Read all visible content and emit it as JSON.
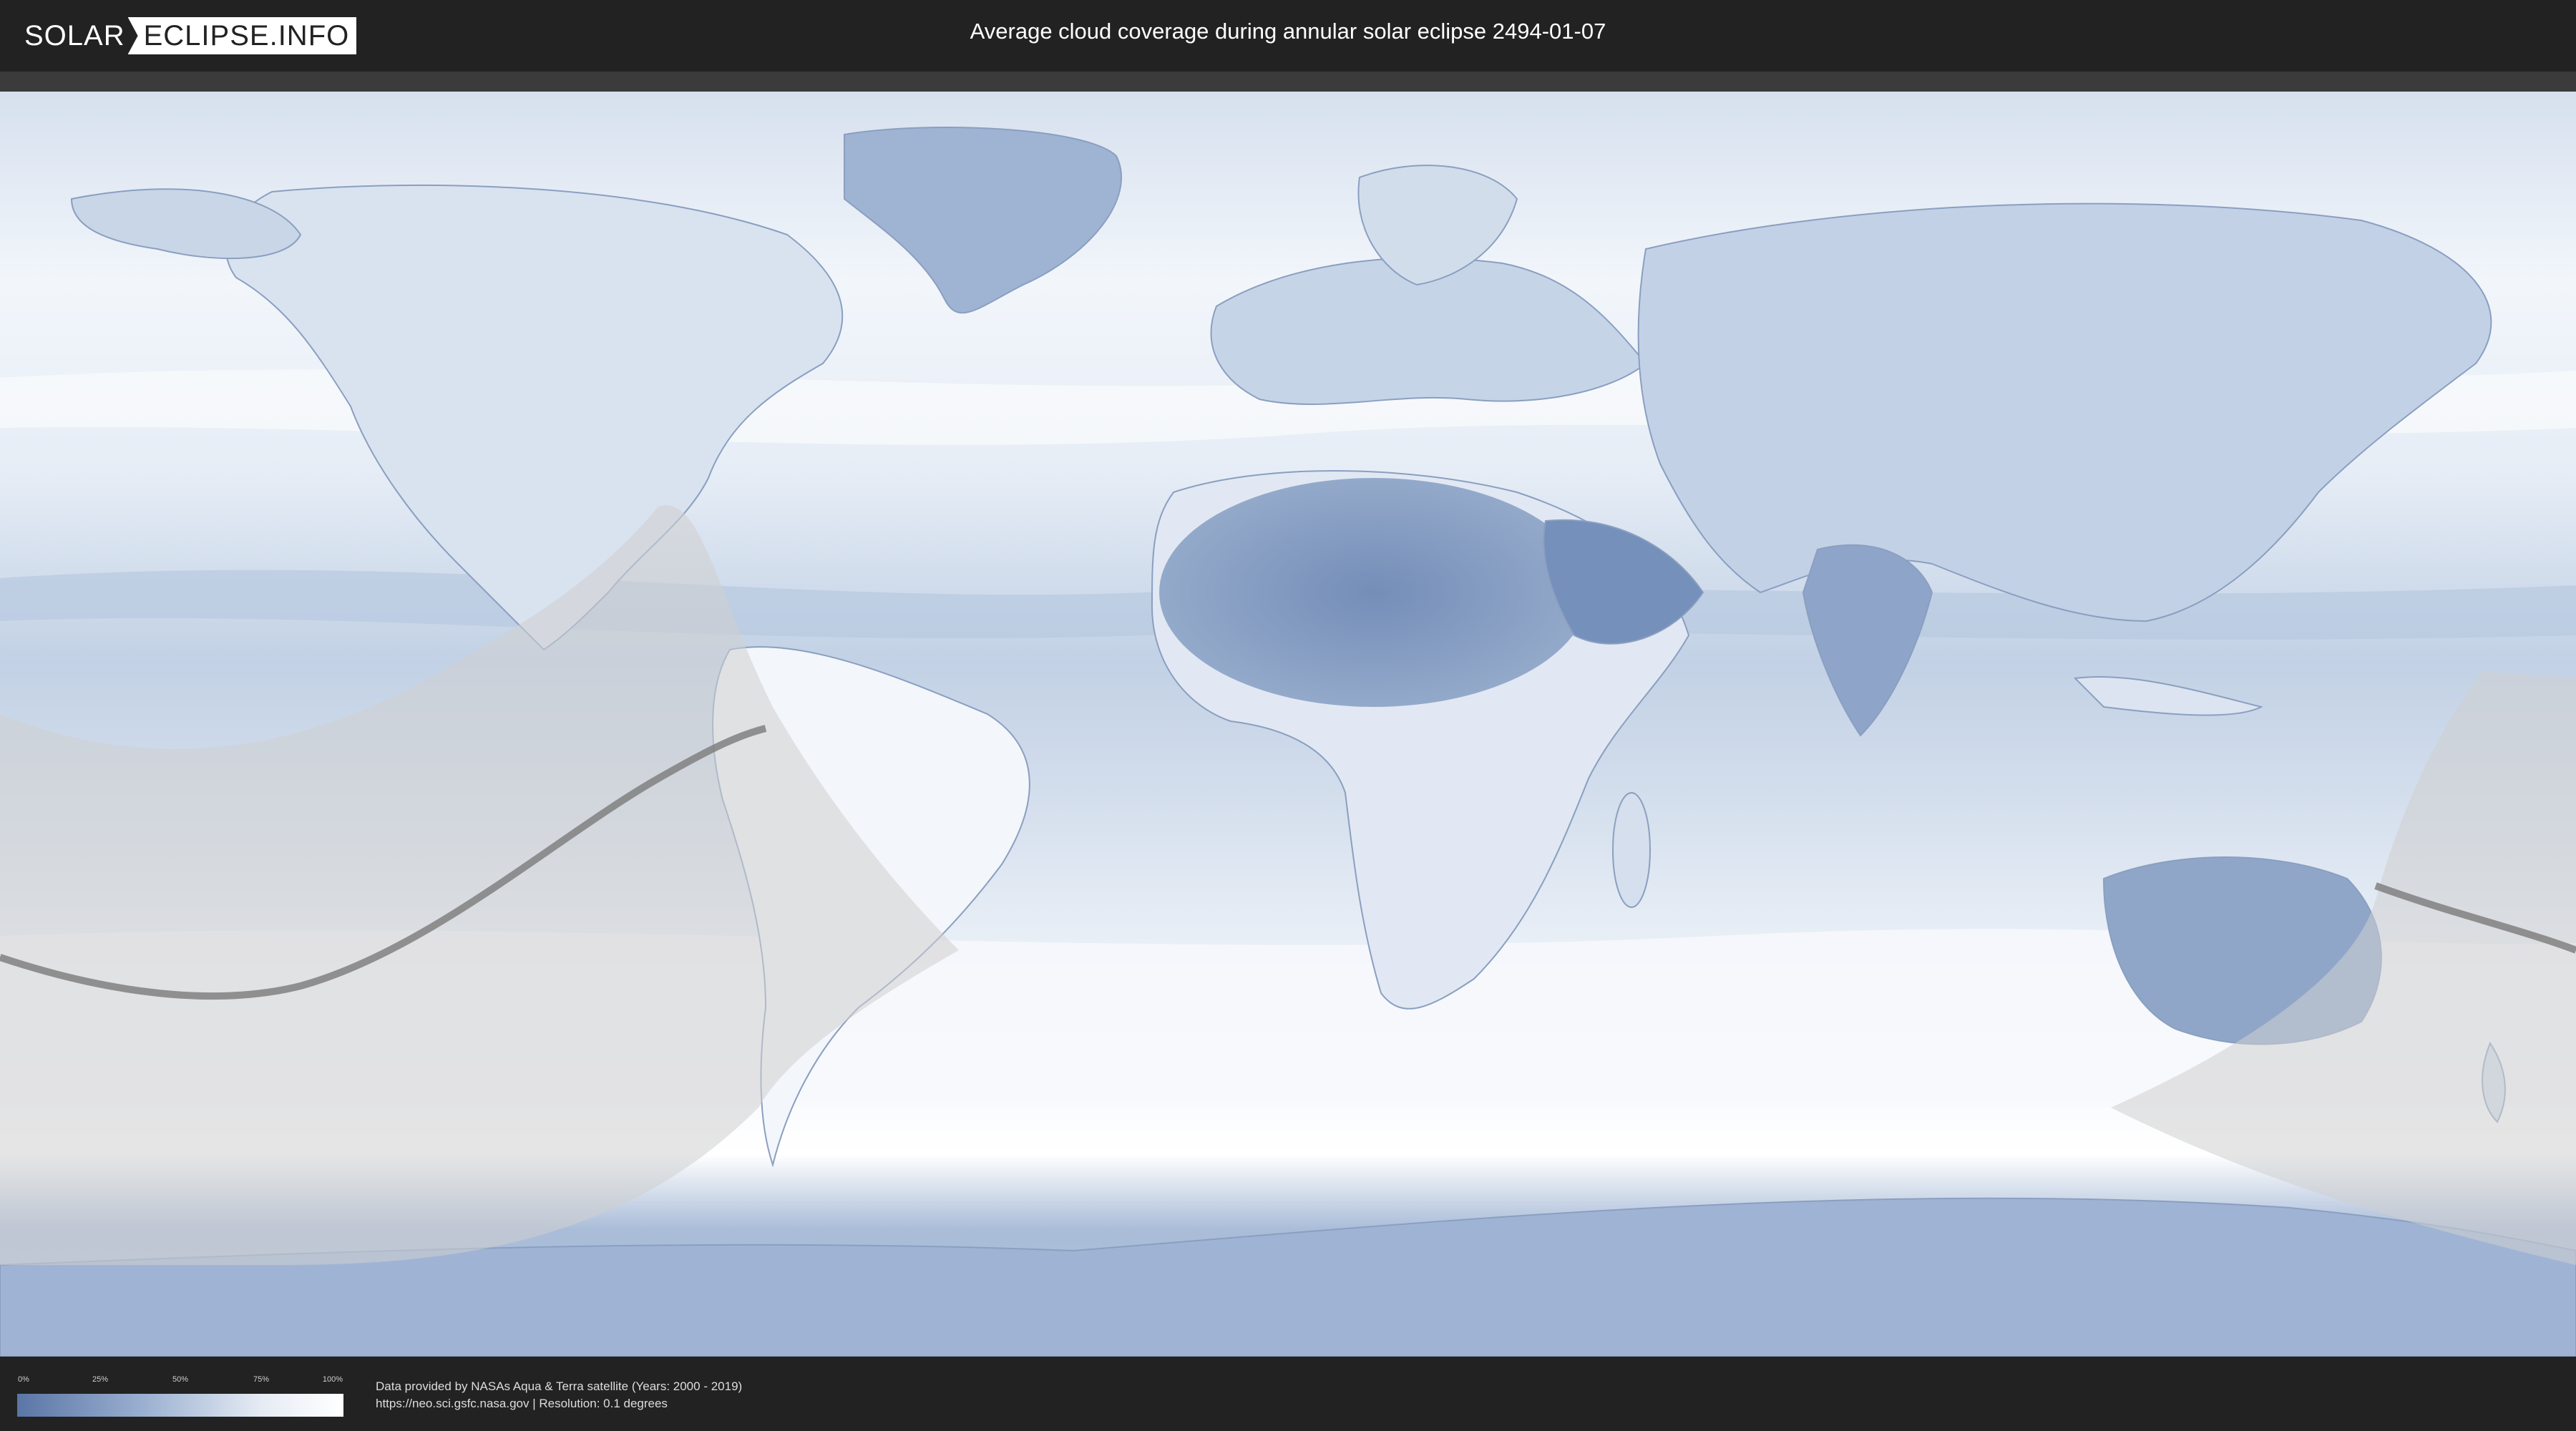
{
  "header": {
    "logo": {
      "part1": "SOLAR",
      "part2": "ECLIPSE.INFO"
    },
    "title": "Average cloud coverage during annular solar eclipse 2494-01-07"
  },
  "legend": {
    "ticks": [
      "0%",
      "25%",
      "50%",
      "75%",
      "100%"
    ],
    "colors": {
      "low": "#5a76a6",
      "high": "#ffffff"
    }
  },
  "credits": {
    "line1": "Data provided by NASAs Aqua & Terra satellite (Years: 2000 - 2019)",
    "line2": "https://neo.sci.gsfc.nasa.gov | Resolution: 0.1 degrees"
  },
  "colors": {
    "ocean_cloud_dense": "#ffffff",
    "ocean_cloud_light": "#9db2d2",
    "land_dry": "#6a84b0",
    "eclipse_overlay": "#d8d8d8",
    "central_line": "#7a7a7a"
  }
}
